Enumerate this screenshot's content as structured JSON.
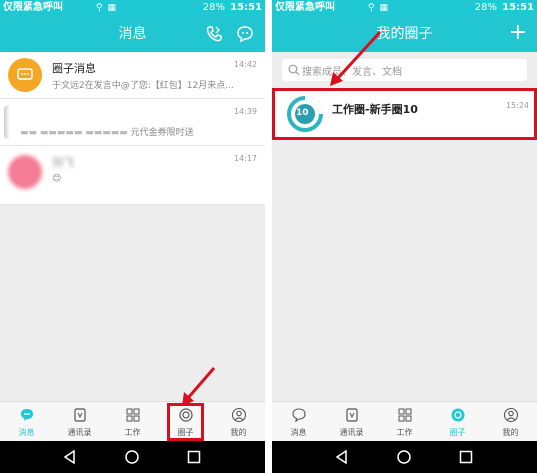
{
  "colors": {
    "accent": "#1ec9d3",
    "highlight": "#d6101c"
  },
  "status": {
    "carrier": "仅限紧急呼叫",
    "battery": "28%",
    "time": "15:51"
  },
  "left": {
    "title": "消息",
    "rows": [
      {
        "title": "圈子消息",
        "subtitle": "于文远2在发言中@了您:【红包】12月来点...",
        "time": "14:42",
        "avatar_color": "#f5a623"
      },
      {
        "title": "",
        "subtitle": "元代金券限时送",
        "time": "14:39",
        "avatar_color": "#ffffff"
      },
      {
        "title": "刘飞",
        "subtitle": "",
        "time": "14:17",
        "avatar_color": "#f06b8a"
      }
    ],
    "tabs": [
      {
        "label": "消息",
        "icon": "chat-icon",
        "active": true
      },
      {
        "label": "通讯录",
        "icon": "contacts-icon",
        "active": false
      },
      {
        "label": "工作",
        "icon": "grid-icon",
        "active": false
      },
      {
        "label": "圈子",
        "icon": "circle-icon",
        "active": false
      },
      {
        "label": "我的",
        "icon": "profile-icon",
        "active": false
      }
    ]
  },
  "right": {
    "title": "我的圈子",
    "add_label": "+",
    "search_placeholder": "搜索成员、发言、文档",
    "circle_item": {
      "name": "工作圈-新手圈10",
      "time": "15:24",
      "badge": "10"
    },
    "tabs": [
      {
        "label": "消息",
        "icon": "chat-icon",
        "active": false
      },
      {
        "label": "通讯录",
        "icon": "contacts-icon",
        "active": false
      },
      {
        "label": "工作",
        "icon": "grid-icon",
        "active": false
      },
      {
        "label": "圈子",
        "icon": "circle-icon",
        "active": true
      },
      {
        "label": "我的",
        "icon": "profile-icon",
        "active": false
      }
    ]
  }
}
